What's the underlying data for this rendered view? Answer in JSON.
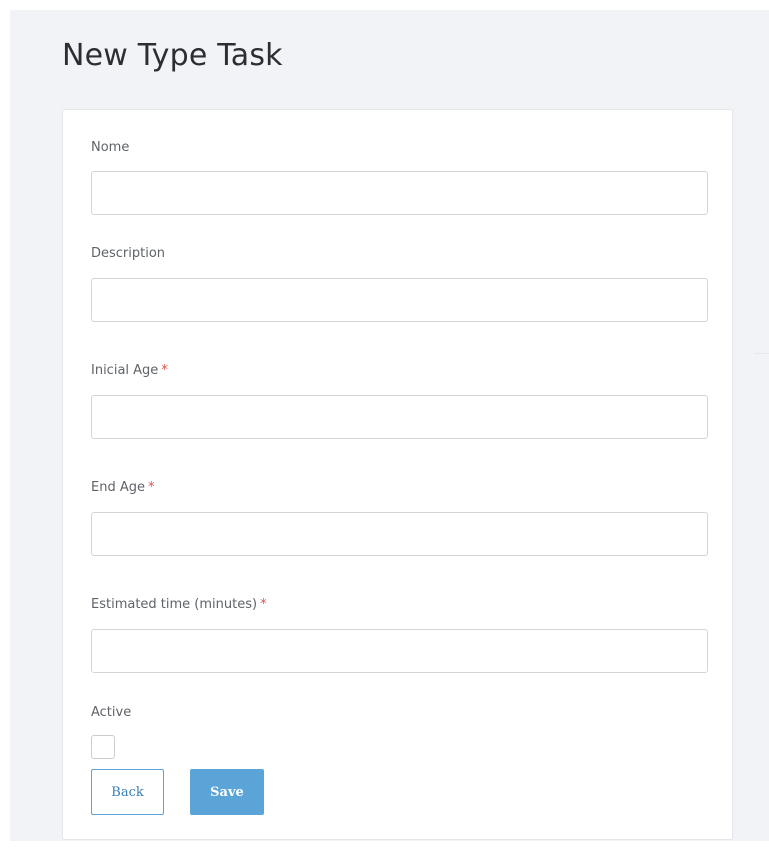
{
  "page": {
    "title": "New Type Task"
  },
  "form": {
    "fields": [
      {
        "label": "Nome",
        "required": false,
        "value": "",
        "placeholder": ""
      },
      {
        "label": "Description",
        "required": false,
        "value": "",
        "placeholder": ""
      },
      {
        "label": "Inicial Age",
        "required": true,
        "value": "",
        "placeholder": ""
      },
      {
        "label": "End Age",
        "required": true,
        "value": "",
        "placeholder": ""
      },
      {
        "label": "Estimated time (minutes)",
        "required": true,
        "value": "",
        "placeholder": ""
      }
    ],
    "required_marker": "*",
    "active": {
      "label": "Active",
      "checked": false
    },
    "buttons": {
      "back_label": "Back",
      "save_label": "Save"
    }
  },
  "colors": {
    "background": "#f1f3f6",
    "card": "#ffffff",
    "primary": "#5aa4d8",
    "required": "#d9534f"
  }
}
